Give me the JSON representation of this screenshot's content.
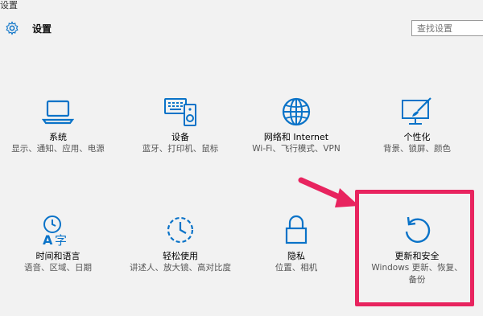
{
  "window": {
    "title": "设置"
  },
  "header": {
    "title": "设置",
    "search_placeholder": "查找设置"
  },
  "accent_color": "#0a73c8",
  "highlight_color": "#e8245f",
  "tiles": [
    {
      "icon": "laptop-icon",
      "label": "系统",
      "desc": "显示、通知、应用、电源"
    },
    {
      "icon": "devices-icon",
      "label": "设备",
      "desc": "蓝牙、打印机、鼠标"
    },
    {
      "icon": "globe-icon",
      "label": "网络和 Internet",
      "desc": "Wi-Fi、飞行模式、VPN"
    },
    {
      "icon": "personalize-icon",
      "label": "个性化",
      "desc": "背景、锁屏、颜色"
    },
    {
      "icon": "time-language-icon",
      "label": "时间和语言",
      "desc": "语音、区域、日期"
    },
    {
      "icon": "ease-of-access-icon",
      "label": "轻松使用",
      "desc": "讲述人、放大镜、高对比度"
    },
    {
      "icon": "lock-icon",
      "label": "隐私",
      "desc": "位置、相机"
    },
    {
      "icon": "refresh-icon",
      "label": "更新和安全",
      "desc": "Windows 更新、恢复、备份"
    }
  ]
}
